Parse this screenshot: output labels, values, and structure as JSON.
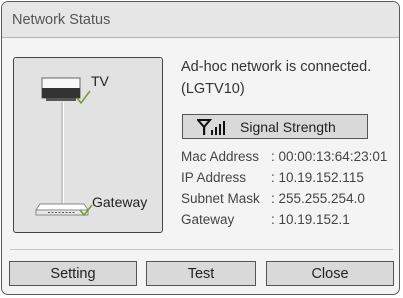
{
  "dialog": {
    "title": "Network Status"
  },
  "diagram": {
    "tv_label": "TV",
    "gateway_label": "Gateway"
  },
  "status": {
    "line1": "Ad-hoc network is connected.",
    "line2": "(LGTV10)"
  },
  "signal": {
    "icon": "signal-strength-icon",
    "label": "Signal Strength"
  },
  "info": [
    {
      "label": "Mac Address",
      "value": ": 00:00:13:64:23:01"
    },
    {
      "label": "IP Address",
      "value": ": 10.19.152.115"
    },
    {
      "label": "Subnet Mask",
      "value": ": 255.255.254.0"
    },
    {
      "label": "Gateway",
      "value": ": 10.19.152.1"
    }
  ],
  "buttons": {
    "setting": "Setting",
    "test": "Test",
    "close": "Close"
  },
  "colors": {
    "dialog_bg": "#f4f4f4",
    "button_bg": "#d9d9d9",
    "border": "#555555",
    "check": "#7a9a3a"
  }
}
